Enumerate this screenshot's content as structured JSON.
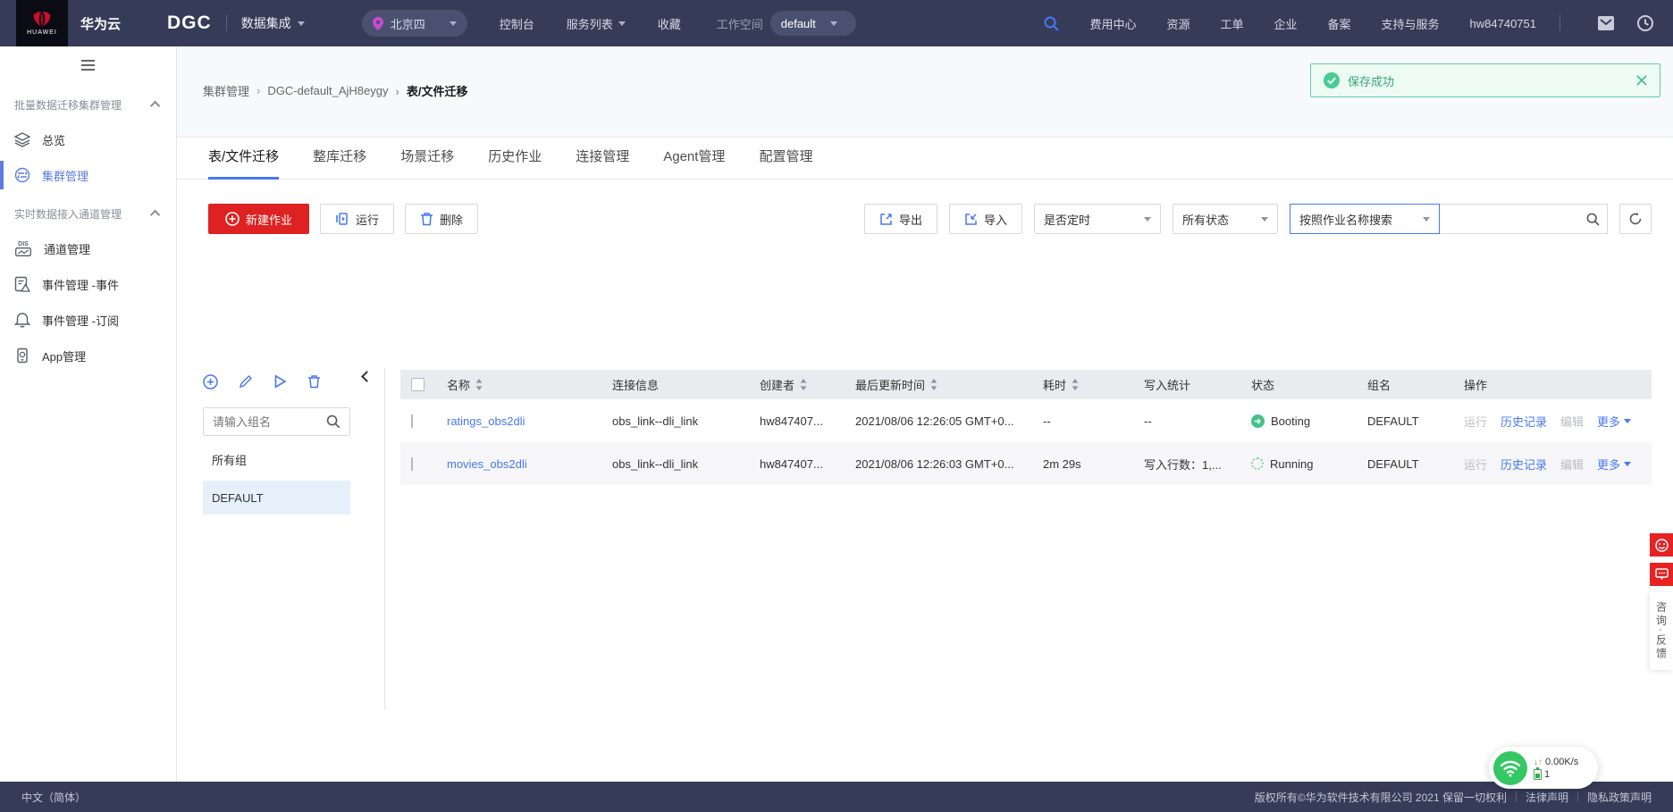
{
  "topbar": {
    "logo_text": "HUAWEI",
    "brand": "华为云",
    "product": "DGC",
    "product_menu": "数据集成",
    "region": "北京四",
    "nav_left": [
      "控制台",
      "服务列表",
      "收藏"
    ],
    "workspace_label": "工作空间",
    "workspace_value": "default",
    "nav_right": [
      "费用中心",
      "资源",
      "工单",
      "企业",
      "备案",
      "支持与服务",
      "hw84740751"
    ]
  },
  "sidebar": {
    "group1_label": "批量数据迁移集群管理",
    "group2_label": "实时数据接入通道管理",
    "item_overview": "总览",
    "item_cluster": "集群管理",
    "item_channel": "通道管理",
    "item_event": "事件管理 -事件",
    "item_subscribe": "事件管理 -订阅",
    "item_app": "App管理",
    "dis_icon_text": "DIS"
  },
  "breadcrumb": {
    "items": [
      "集群管理",
      "DGC-default_AjH8eygy",
      "表/文件迁移"
    ]
  },
  "toast": {
    "message": "保存成功"
  },
  "tabs": [
    {
      "label": "表/文件迁移"
    },
    {
      "label": "整库迁移"
    },
    {
      "label": "场景迁移"
    },
    {
      "label": "历史作业"
    },
    {
      "label": "连接管理"
    },
    {
      "label": "Agent管理"
    },
    {
      "label": "配置管理"
    }
  ],
  "toolbar": {
    "new_job": "新建作业",
    "run": "运行",
    "delete": "删除",
    "export": "导出",
    "import": "导入",
    "filter_schedule": "是否定时",
    "filter_status": "所有状态",
    "search_mode": "按照作业名称搜索"
  },
  "group_panel": {
    "search_placeholder": "请输入组名",
    "all_groups": "所有组",
    "selected_group": "DEFAULT"
  },
  "table": {
    "columns": [
      "名称",
      "连接信息",
      "创建者",
      "最后更新时间",
      "耗时",
      "写入统计",
      "状态",
      "组名",
      "操作"
    ],
    "rows": [
      {
        "name": "ratings_obs2dli",
        "link": "obs_link--dli_link",
        "creator": "hw847407...",
        "updated": "2021/08/06 12:26:05 GMT+0...",
        "duration": "--",
        "write_stats": "--",
        "status": "Booting",
        "group": "DEFAULT"
      },
      {
        "name": "movies_obs2dli",
        "link": "obs_link--dli_link",
        "creator": "hw847407...",
        "updated": "2021/08/06 12:26:03 GMT+0...",
        "duration": "2m 29s",
        "write_stats": "写入行数：1,...",
        "status": "Running",
        "group": "DEFAULT"
      }
    ],
    "actions": {
      "run": "运行",
      "history": "历史记录",
      "edit": "编辑",
      "more": "更多"
    }
  },
  "net_widget": {
    "speed": "0.00K/s",
    "count": "1"
  },
  "feedback": {
    "label": "咨询·反馈"
  },
  "footer": {
    "language": "中文（简体）",
    "copyright": "版权所有©华为软件技术有限公司 2021 保留一切权利",
    "legal": "法律声明",
    "privacy": "隐私政策声明"
  },
  "colors": {
    "accent_blue": "#4678f2",
    "sidebar_blue": "#5e7ce0",
    "success_green": "#47cc96",
    "brand_red": "#de2121",
    "header_navy": "#363c58"
  }
}
